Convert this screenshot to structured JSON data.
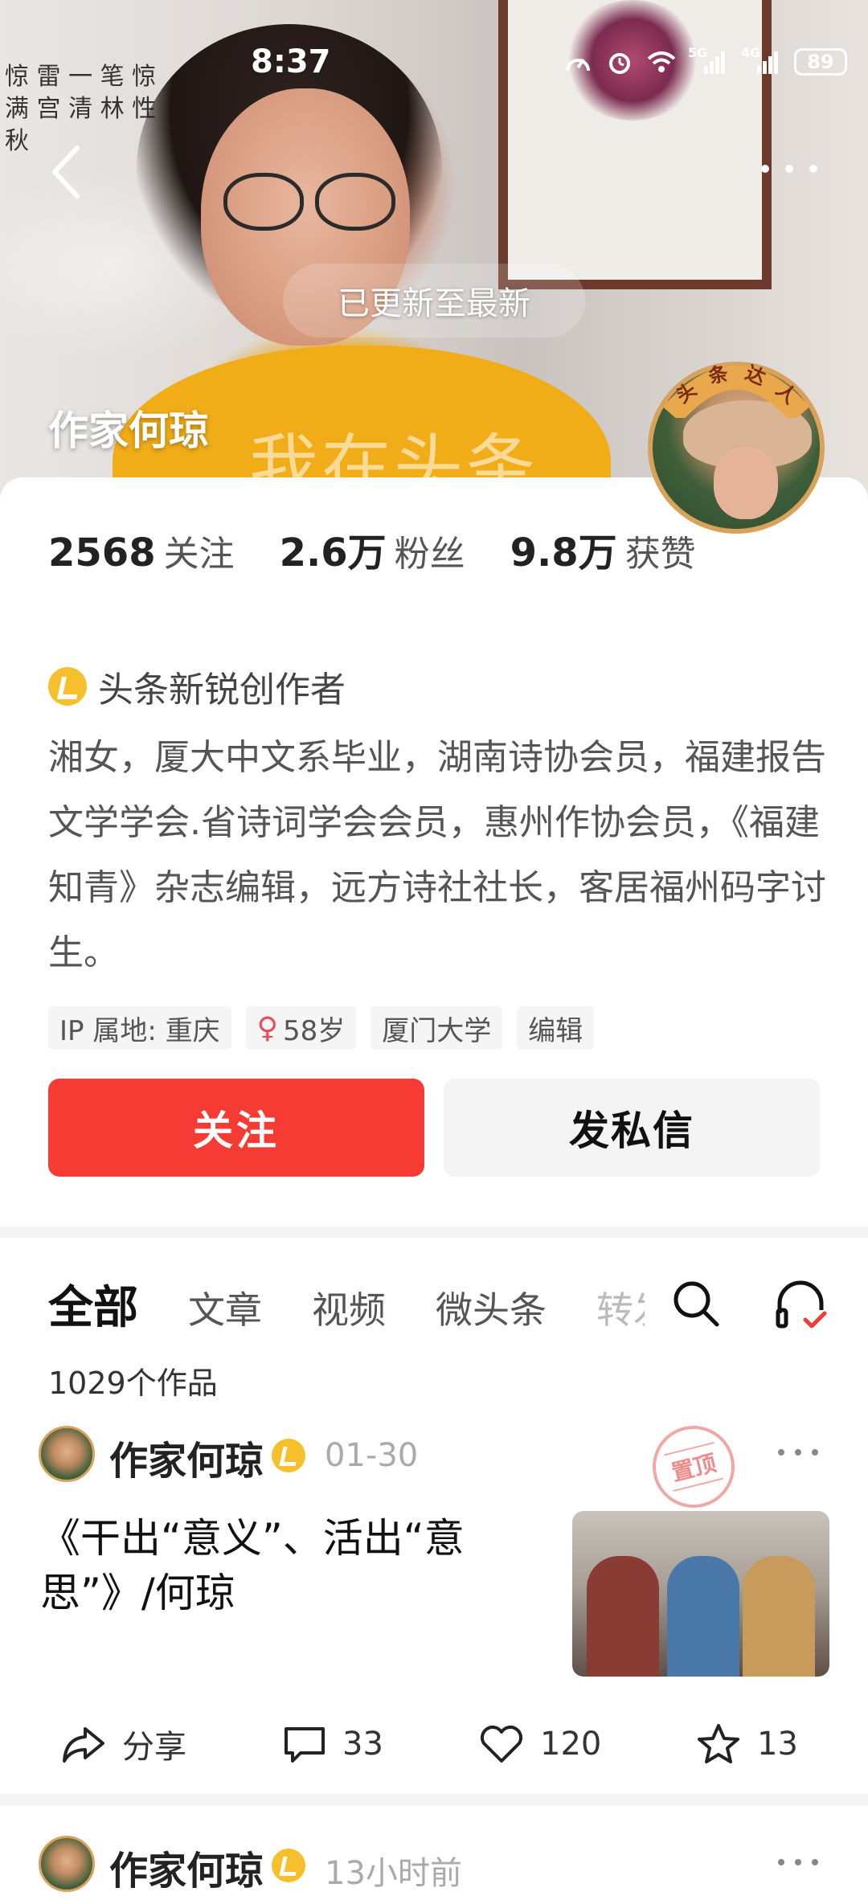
{
  "status_bar": {
    "time": "8:37",
    "signal_5g": "5G",
    "signal_4g": "4G",
    "battery": "89"
  },
  "banner": {
    "calligraphy": "惊 雷 一 笔 惊 满 宫 清 林 性 秋",
    "overlay_text": "我在头条",
    "toast": "已更新至最新",
    "profile_name": "作家何琼",
    "badge_text": "头条达人"
  },
  "stats": {
    "following_value": "2568",
    "following_label": "关注",
    "fans_value": "2.6万",
    "fans_label": "粉丝",
    "likes_value": "9.8万",
    "likes_label": "获赞"
  },
  "verified_label": "头条新锐创作者",
  "bio": "湘女，厦大中文系毕业，湖南诗协会员，福建报告文学学会.省诗词学会会员，惠州作协会员，《福建知青》杂志编辑，远方诗社社长，客居福州码字讨生。",
  "tags": {
    "ip": "IP 属地: 重庆",
    "gender_symbol": "♀",
    "age": "58岁",
    "school": "厦门大学",
    "job": "编辑"
  },
  "buttons": {
    "follow": "关注",
    "message": "发私信"
  },
  "tabs": [
    "全部",
    "文章",
    "视频",
    "微头条",
    "转发"
  ],
  "works_count": "1029个作品",
  "posts": [
    {
      "author": "作家何琼",
      "time": "01-30",
      "pinned_stamp": "置顶",
      "title": "《干出“意义”、活出“意思”》/何琼",
      "share_label": "分享",
      "comments": "33",
      "likes": "120",
      "favorites": "13"
    },
    {
      "author": "作家何琼",
      "time": "13小时前"
    }
  ],
  "colors": {
    "accent_red": "#f53b33",
    "badge_yellow": "#f5c02b"
  }
}
